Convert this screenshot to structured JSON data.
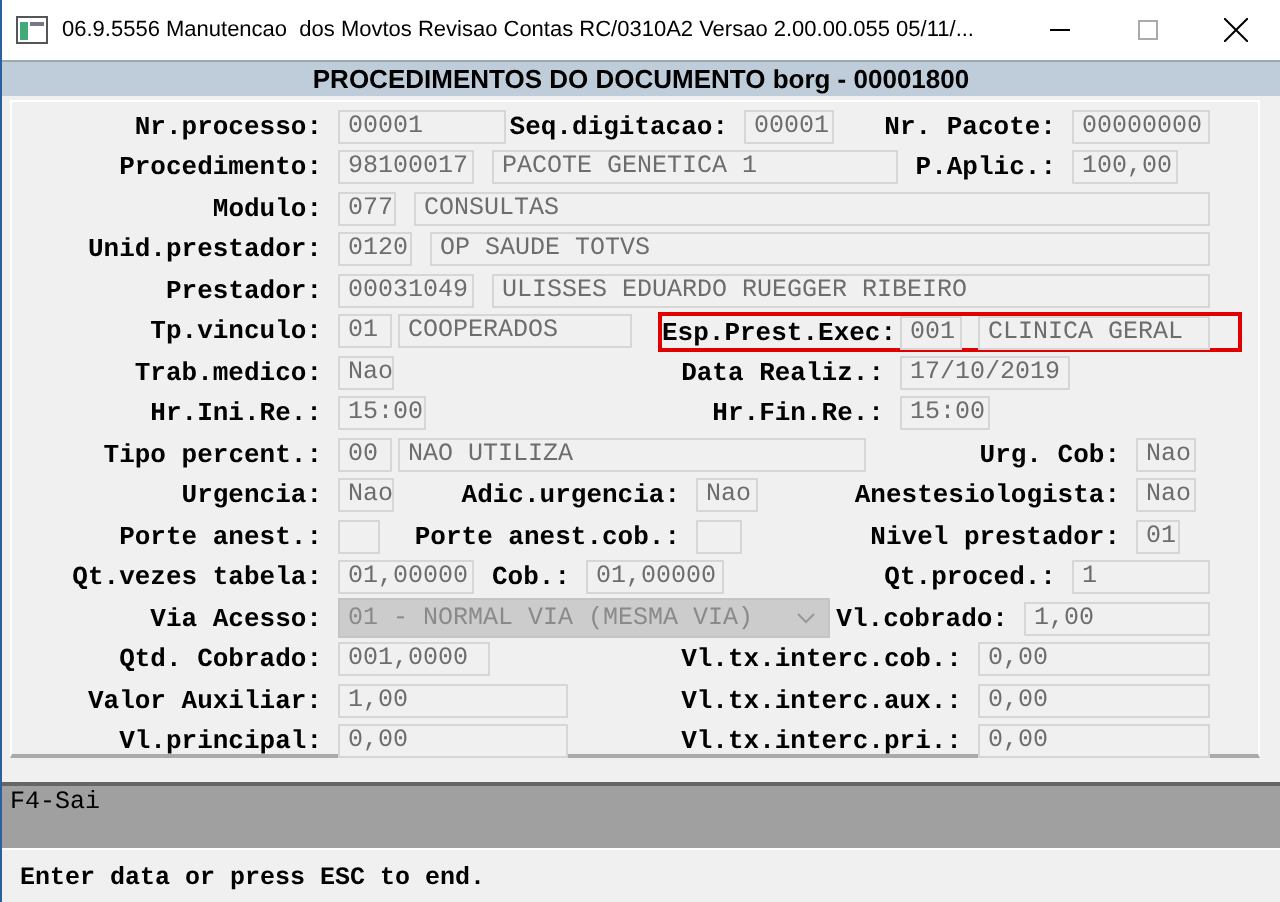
{
  "window": {
    "title": "06.9.5556 Manutencao  dos Movtos Revisao Contas RC/0310A2 Versao 2.00.00.055 05/11/..."
  },
  "header": "PROCEDIMENTOS DO DOCUMENTO borg - 00001800",
  "rows": [
    {
      "items": [
        {
          "kind": "label",
          "text": "Nr.processo:"
        },
        {
          "kind": "field",
          "value": "00001"
        },
        {
          "kind": "label",
          "text": "Seq.digitacao:"
        },
        {
          "kind": "field",
          "value": "00001"
        },
        {
          "kind": "label",
          "text": "Nr. Pacote:"
        },
        {
          "kind": "field",
          "value": "00000000"
        }
      ]
    },
    {
      "items": [
        {
          "kind": "label",
          "text": "Procedimento:"
        },
        {
          "kind": "field",
          "value": "98100017"
        },
        {
          "kind": "field",
          "value": "PACOTE GENETICA 1"
        },
        {
          "kind": "label",
          "text": "P.Aplic.:"
        },
        {
          "kind": "field",
          "value": "100,00"
        }
      ]
    },
    {
      "items": [
        {
          "kind": "label",
          "text": "Modulo:"
        },
        {
          "kind": "field",
          "value": "077"
        },
        {
          "kind": "field",
          "value": "CONSULTAS"
        }
      ]
    },
    {
      "items": [
        {
          "kind": "label",
          "text": "Unid.prestador:"
        },
        {
          "kind": "field",
          "value": "0120"
        },
        {
          "kind": "field",
          "value": "OP SAUDE TOTVS"
        }
      ]
    },
    {
      "items": [
        {
          "kind": "label",
          "text": "Prestador:"
        },
        {
          "kind": "field",
          "value": "00031049"
        },
        {
          "kind": "field",
          "value": "ULISSES EDUARDO RUEGGER RIBEIRO"
        }
      ]
    },
    {
      "items": [
        {
          "kind": "label",
          "text": "Tp.vinculo:"
        },
        {
          "kind": "field",
          "value": "01"
        },
        {
          "kind": "field",
          "value": "COOPERADOS"
        },
        {
          "kind": "group",
          "highlighted": true,
          "items": [
            {
              "kind": "label",
              "text": "Esp.Prest.Exec:"
            },
            {
              "kind": "field",
              "value": "001"
            },
            {
              "kind": "field",
              "value": "CLINICA GERAL"
            }
          ]
        }
      ]
    },
    {
      "items": [
        {
          "kind": "label",
          "text": "Trab.medico:"
        },
        {
          "kind": "field",
          "value": "Nao"
        },
        {
          "kind": "label",
          "text": "Data Realiz.:"
        },
        {
          "kind": "field",
          "value": "17/10/2019"
        }
      ]
    },
    {
      "items": [
        {
          "kind": "label",
          "text": "Hr.Ini.Re.:"
        },
        {
          "kind": "field",
          "value": "15:00"
        },
        {
          "kind": "label",
          "text": "Hr.Fin.Re.:"
        },
        {
          "kind": "field",
          "value": "15:00"
        }
      ]
    },
    {
      "items": [
        {
          "kind": "label",
          "text": "Tipo percent.:"
        },
        {
          "kind": "field",
          "value": "00"
        },
        {
          "kind": "field",
          "value": "NAO UTILIZA"
        },
        {
          "kind": "label",
          "text": "Urg. Cob:"
        },
        {
          "kind": "field",
          "value": "Nao"
        }
      ]
    },
    {
      "items": [
        {
          "kind": "label",
          "text": "Urgencia:"
        },
        {
          "kind": "field",
          "value": "Nao"
        },
        {
          "kind": "label",
          "text": "Adic.urgencia:"
        },
        {
          "kind": "field",
          "value": "Nao"
        },
        {
          "kind": "label",
          "text": "Anestesiologista:"
        },
        {
          "kind": "field",
          "value": "Nao"
        }
      ]
    },
    {
      "items": [
        {
          "kind": "label",
          "text": "Porte anest.:"
        },
        {
          "kind": "field"
        },
        {
          "kind": "label",
          "text": "Porte anest.cob.:"
        },
        {
          "kind": "field"
        },
        {
          "kind": "label",
          "text": "Nivel prestador:"
        },
        {
          "kind": "field",
          "value": "01"
        }
      ]
    },
    {
      "items": [
        {
          "kind": "label",
          "text": "Qt.vezes tabela:"
        },
        {
          "kind": "field",
          "value": "01,00000"
        },
        {
          "kind": "label",
          "text": "Cob.:"
        },
        {
          "kind": "field",
          "value": "01,00000"
        },
        {
          "kind": "label",
          "text": "Qt.proced.:"
        },
        {
          "kind": "field",
          "value": "1"
        }
      ]
    },
    {
      "items": [
        {
          "kind": "label",
          "text": "Via Acesso:"
        },
        {
          "kind": "select",
          "value": "01 - NORMAL VIA (MESMA VIA)",
          "disabled": true
        },
        {
          "kind": "label",
          "text": "Vl.cobrado:"
        },
        {
          "kind": "field",
          "value": "1,00"
        }
      ]
    },
    {
      "items": [
        {
          "kind": "label",
          "text": "Qtd. Cobrado:"
        },
        {
          "kind": "field",
          "value": "001,0000"
        },
        {
          "kind": "label",
          "text": "Vl.tx.interc.cob.:"
        },
        {
          "kind": "field",
          "value": "0,00"
        }
      ]
    },
    {
      "items": [
        {
          "kind": "label",
          "text": "Valor Auxiliar:"
        },
        {
          "kind": "field",
          "value": "1,00"
        },
        {
          "kind": "label",
          "text": "Vl.tx.interc.aux.:"
        },
        {
          "kind": "field",
          "value": "0,00"
        }
      ]
    },
    {
      "items": [
        {
          "kind": "label",
          "text": "Vl.principal:"
        },
        {
          "kind": "field",
          "value": "0,00"
        },
        {
          "kind": "label",
          "text": "Vl.tx.interc.pri.:"
        },
        {
          "kind": "field",
          "value": "0,00"
        }
      ]
    }
  ],
  "function_keys": "F4-Sai",
  "status_message": "Enter data or press ESC to end."
}
